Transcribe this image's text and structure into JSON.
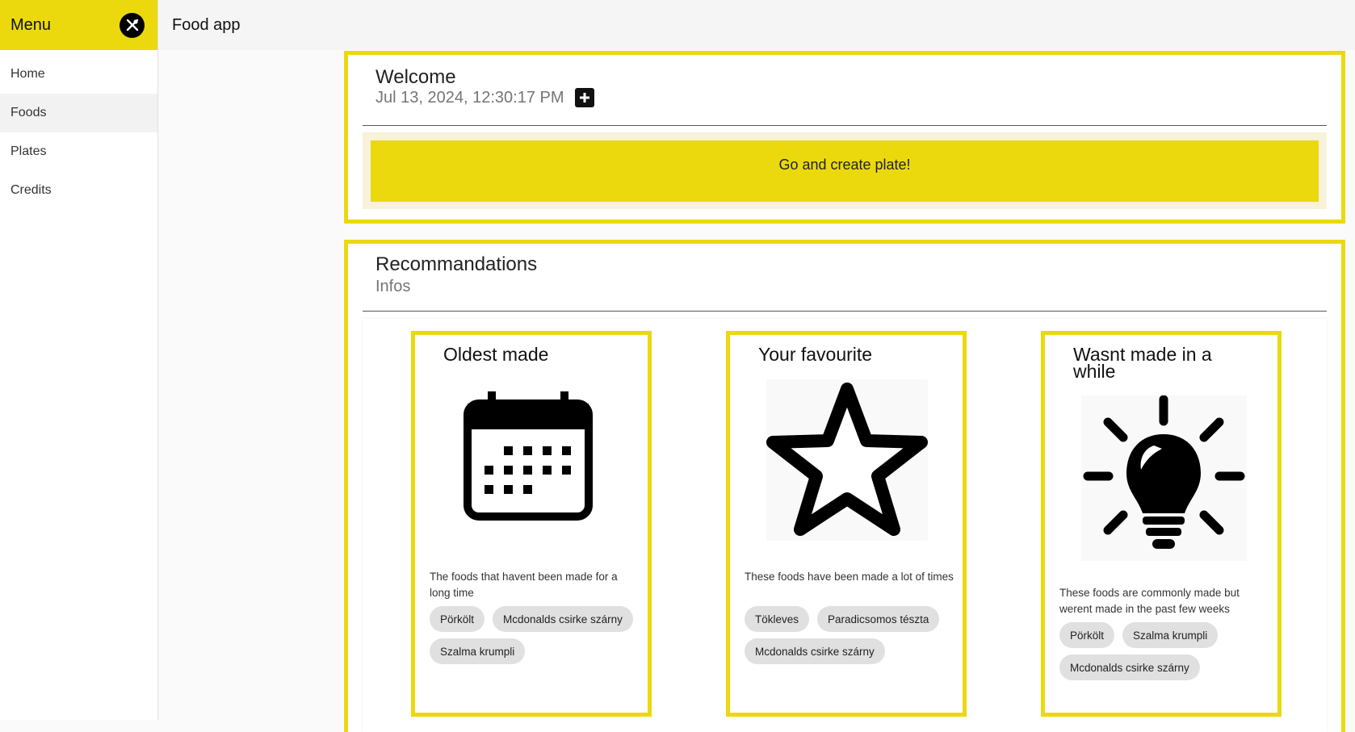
{
  "sidebar": {
    "title": "Menu",
    "close_icon": "utensils-close-icon",
    "items": [
      {
        "label": "Home",
        "active": false
      },
      {
        "label": "Foods",
        "active": true
      },
      {
        "label": "Plates",
        "active": false
      },
      {
        "label": "Credits",
        "active": false
      }
    ]
  },
  "topbar": {
    "title": "Food app"
  },
  "welcome": {
    "title": "Welcome",
    "datetime": "Jul 13, 2024, 12:30:17 PM",
    "add_icon": "plus-box-icon",
    "create_button": "Go and create plate!"
  },
  "recommendations": {
    "title": "Recommandations",
    "subtitle": "Infos",
    "cards": [
      {
        "title": "Oldest made",
        "icon": "calendar-icon",
        "description": "The foods that havent been made for a long time",
        "chips": [
          "Pörkölt",
          "Mcdonalds csirke szárny",
          "Szalma krumpli"
        ]
      },
      {
        "title": "Your favourite",
        "icon": "star-icon",
        "description": "These foods have been made a lot of times",
        "chips": [
          "Tökleves",
          "Paradicsomos tészta",
          "Mcdonalds csirke szárny"
        ]
      },
      {
        "title": "Wasnt made in a while",
        "icon": "lightbulb-icon",
        "description": "These foods are commonly made but werent made in the past few weeks",
        "chips": [
          "Pörkölt",
          "Szalma krumpli",
          "Mcdonalds csirke szárny"
        ]
      }
    ]
  },
  "colors": {
    "accent": "#ebd90e",
    "chip": "#e0e0e0"
  }
}
